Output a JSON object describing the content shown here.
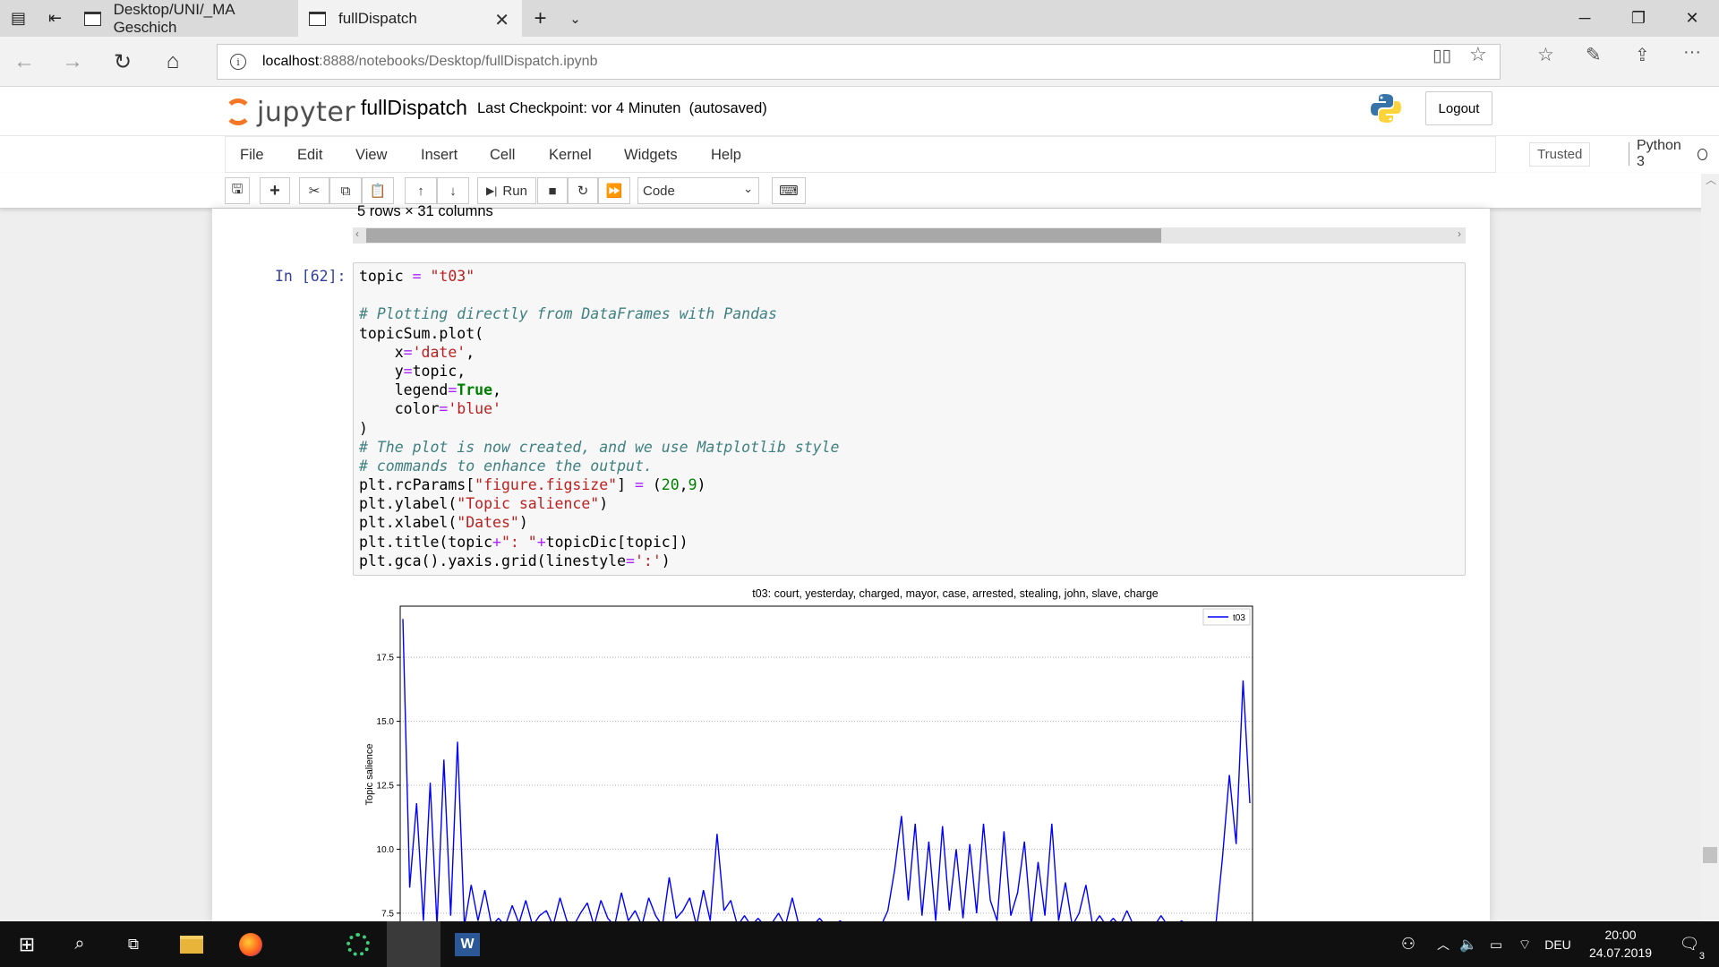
{
  "browser": {
    "tabs": [
      {
        "title": "Desktop/UNI/_MA Geschich",
        "active": false
      },
      {
        "title": "fullDispatch",
        "active": true
      }
    ],
    "url_host": "localhost",
    "url_rest": ":8888/notebooks/Desktop/fullDispatch.ipynb"
  },
  "jupyter": {
    "logo_text": "jupyter",
    "notebook_name": "fullDispatch",
    "checkpoint_text": "Last Checkpoint: vor 4 Minuten  (autosaved)",
    "logout_label": "Logout",
    "menu": [
      "File",
      "Edit",
      "View",
      "Insert",
      "Cell",
      "Kernel",
      "Widgets",
      "Help"
    ],
    "trusted_label": "Trusted",
    "kernel_name": "Python 3",
    "toolbar": {
      "run_label": "Run",
      "cell_type": "Code"
    }
  },
  "output_info": "5 rows × 31 columns",
  "cell": {
    "prompt": "In [62]:"
  },
  "chart_data": {
    "type": "line",
    "title": "t03: court, yesterday, charged, mayor, case, arrested, stealing, john, slave, charge",
    "ylabel": "Topic salience",
    "xlabel": "",
    "legend": [
      "t03"
    ],
    "legend_position": "top-right",
    "grid": "y dotted",
    "ylim": [
      6.2,
      19.5
    ],
    "yticks": [
      7.5,
      10.0,
      12.5,
      15.0,
      17.5
    ],
    "ytick_labels": [
      "7.5",
      "10.0",
      "12.5",
      "15.0",
      "17.5"
    ],
    "series": [
      {
        "name": "t03",
        "color": "#0000ff",
        "values": [
          19.0,
          8.5,
          11.8,
          7.2,
          12.6,
          7.0,
          13.5,
          7.4,
          14.2,
          7.0,
          8.6,
          7.2,
          8.4,
          7.0,
          7.3,
          7.0,
          7.8,
          7.1,
          8.0,
          7.0,
          7.4,
          7.6,
          7.0,
          8.1,
          7.2,
          7.0,
          7.5,
          7.9,
          7.0,
          8.0,
          7.3,
          7.0,
          8.3,
          7.2,
          7.6,
          7.0,
          8.1,
          7.4,
          7.0,
          8.9,
          7.3,
          7.6,
          8.1,
          7.0,
          8.4,
          7.2,
          10.6,
          7.6,
          8.0,
          7.0,
          7.4,
          7.0,
          7.3,
          7.0,
          7.1,
          7.5,
          7.0,
          8.1,
          7.0,
          7.1,
          7.0,
          7.3,
          7.0,
          7.0,
          7.2,
          7.0,
          7.0,
          7.1,
          7.0,
          7.0,
          7.0,
          7.6,
          9.2,
          11.3,
          8.0,
          11.0,
          7.4,
          10.3,
          7.2,
          10.9,
          7.6,
          10.0,
          7.3,
          10.2,
          7.5,
          11.0,
          8.0,
          7.2,
          10.7,
          7.4,
          8.3,
          10.3,
          7.0,
          9.5,
          7.4,
          11.0,
          7.2,
          8.7,
          7.0,
          7.5,
          8.6,
          7.0,
          7.4,
          7.0,
          7.3,
          7.0,
          7.6,
          7.0,
          7.1,
          7.0,
          7.0,
          7.4,
          7.0,
          7.0,
          7.2,
          7.0,
          7.0,
          7.0,
          7.1,
          7.0,
          9.7,
          12.9,
          10.2,
          16.6,
          11.8
        ]
      }
    ]
  },
  "taskbar": {
    "language": "DEU",
    "time": "20:00",
    "date": "24.07.2019",
    "notification_count": "3"
  }
}
